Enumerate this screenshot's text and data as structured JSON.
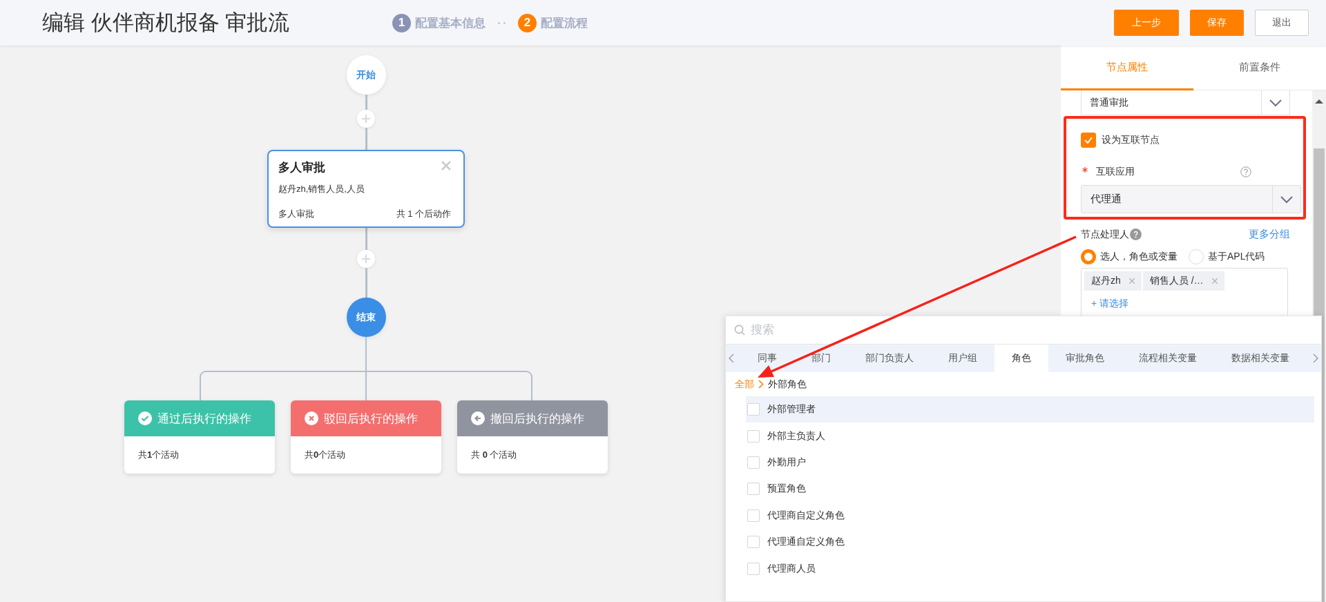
{
  "header": {
    "title": "编辑 伙伴商机报备 审批流",
    "steps": [
      {
        "number": "1",
        "label": "配置基本信息",
        "selected": false
      },
      {
        "number": "2",
        "label": "配置流程",
        "selected": true
      }
    ],
    "buttons": [
      {
        "label": "上一步",
        "kind": "primary"
      },
      {
        "label": "保存",
        "kind": "primary"
      },
      {
        "label": "退出",
        "kind": "default"
      }
    ]
  },
  "flow": {
    "start": "开始",
    "node": {
      "title": "多人审批",
      "assignees": "赵丹zh,销售人员,人员",
      "type": "多人审批",
      "actions": "共 1 个后动作"
    },
    "end": "结束",
    "branches": [
      {
        "kind": "approve",
        "title": "通过后执行的操作",
        "color": "#3cc2a8",
        "summary": "共**1**个活动"
      },
      {
        "kind": "reject",
        "title": "驳回后执行的操作",
        "color": "#f46e6e",
        "summary": "共**0**个活动"
      },
      {
        "kind": "withdraw",
        "title": "撤回后执行的操作",
        "color": "#90949e",
        "summary": "共 **0** 个活动"
      }
    ]
  },
  "panel": {
    "tabs": [
      {
        "label": "节点属性",
        "selected": true
      },
      {
        "label": "前置条件",
        "selected": false
      }
    ],
    "approval_type": "普通审批",
    "interconnect": {
      "label": "设为互联节点",
      "checked": true
    },
    "app_field": {
      "label": "互联应用",
      "required": true,
      "value": "代理通"
    },
    "handler": {
      "label": "节点处理人",
      "more_link": "更多分组",
      "options": [
        {
          "label": "选人，角色或变量",
          "selected": true
        },
        {
          "label": "基于APL代码",
          "selected": false
        }
      ],
      "tags": [
        "赵丹zh",
        "销售人员 /…"
      ],
      "add_link": "+ 请选择"
    }
  },
  "picker": {
    "search_placeholder": "搜索",
    "tabs": [
      {
        "label": "同事",
        "selected": false
      },
      {
        "label": "部门",
        "selected": false
      },
      {
        "label": "部门负责人",
        "selected": false
      },
      {
        "label": "用户组",
        "selected": false
      },
      {
        "label": "角色",
        "selected": true
      },
      {
        "label": "审批角色",
        "selected": false
      },
      {
        "label": "流程相关变量",
        "selected": false
      },
      {
        "label": "数据相关变量",
        "selected": false
      }
    ],
    "breadcrumb": {
      "root": "全部",
      "current": "外部角色"
    },
    "items": [
      {
        "label": "外部管理者",
        "checked": false,
        "hovered": true
      },
      {
        "label": "外部主负责人",
        "checked": false,
        "hovered": false
      },
      {
        "label": "外勤用户",
        "checked": false,
        "hovered": false
      },
      {
        "label": "预置角色",
        "checked": false,
        "hovered": false
      },
      {
        "label": "代理商自定义角色",
        "checked": false,
        "hovered": false
      },
      {
        "label": "代理通自定义角色",
        "checked": false,
        "hovered": false
      },
      {
        "label": "代理商人员",
        "checked": false,
        "hovered": false
      }
    ]
  }
}
